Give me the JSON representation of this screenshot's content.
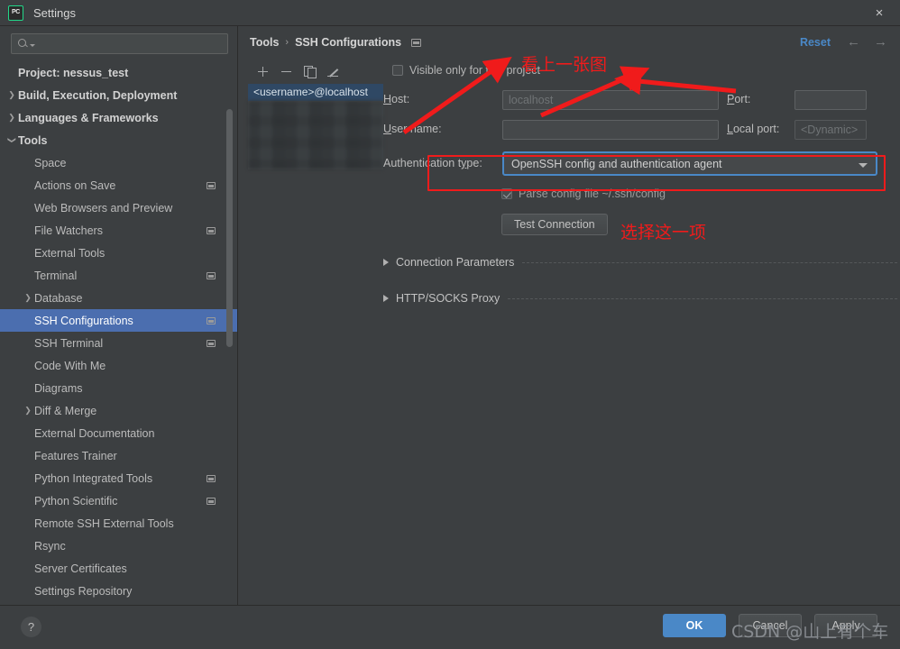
{
  "window": {
    "title": "Settings",
    "logo_text": "PC",
    "close_icon": "×"
  },
  "sidebar": {
    "search": {
      "value": "",
      "placeholder": ""
    },
    "items": [
      {
        "label": "Project: nessus_test",
        "indent": 0,
        "bold": true,
        "arrow": "",
        "badge": false,
        "selected": false
      },
      {
        "label": "Build, Execution, Deployment",
        "indent": 0,
        "bold": true,
        "arrow": "right",
        "badge": false,
        "selected": false
      },
      {
        "label": "Languages & Frameworks",
        "indent": 0,
        "bold": true,
        "arrow": "right",
        "badge": false,
        "selected": false
      },
      {
        "label": "Tools",
        "indent": 0,
        "bold": true,
        "arrow": "down",
        "badge": false,
        "selected": false
      },
      {
        "label": "Space",
        "indent": 1,
        "bold": false,
        "arrow": "",
        "badge": false,
        "selected": false
      },
      {
        "label": "Actions on Save",
        "indent": 1,
        "bold": false,
        "arrow": "",
        "badge": true,
        "selected": false
      },
      {
        "label": "Web Browsers and Preview",
        "indent": 1,
        "bold": false,
        "arrow": "",
        "badge": false,
        "selected": false
      },
      {
        "label": "File Watchers",
        "indent": 1,
        "bold": false,
        "arrow": "",
        "badge": true,
        "selected": false
      },
      {
        "label": "External Tools",
        "indent": 1,
        "bold": false,
        "arrow": "",
        "badge": false,
        "selected": false
      },
      {
        "label": "Terminal",
        "indent": 1,
        "bold": false,
        "arrow": "",
        "badge": true,
        "selected": false
      },
      {
        "label": "Database",
        "indent": 1,
        "bold": false,
        "arrow": "right",
        "badge": false,
        "selected": false
      },
      {
        "label": "SSH Configurations",
        "indent": 1,
        "bold": false,
        "arrow": "",
        "badge": true,
        "selected": true
      },
      {
        "label": "SSH Terminal",
        "indent": 1,
        "bold": false,
        "arrow": "",
        "badge": true,
        "selected": false
      },
      {
        "label": "Code With Me",
        "indent": 1,
        "bold": false,
        "arrow": "",
        "badge": false,
        "selected": false
      },
      {
        "label": "Diagrams",
        "indent": 1,
        "bold": false,
        "arrow": "",
        "badge": false,
        "selected": false
      },
      {
        "label": "Diff & Merge",
        "indent": 1,
        "bold": false,
        "arrow": "right",
        "badge": false,
        "selected": false
      },
      {
        "label": "External Documentation",
        "indent": 1,
        "bold": false,
        "arrow": "",
        "badge": false,
        "selected": false
      },
      {
        "label": "Features Trainer",
        "indent": 1,
        "bold": false,
        "arrow": "",
        "badge": false,
        "selected": false
      },
      {
        "label": "Python Integrated Tools",
        "indent": 1,
        "bold": false,
        "arrow": "",
        "badge": true,
        "selected": false
      },
      {
        "label": "Python Scientific",
        "indent": 1,
        "bold": false,
        "arrow": "",
        "badge": true,
        "selected": false
      },
      {
        "label": "Remote SSH External Tools",
        "indent": 1,
        "bold": false,
        "arrow": "",
        "badge": false,
        "selected": false
      },
      {
        "label": "Rsync",
        "indent": 1,
        "bold": false,
        "arrow": "",
        "badge": false,
        "selected": false
      },
      {
        "label": "Server Certificates",
        "indent": 1,
        "bold": false,
        "arrow": "",
        "badge": false,
        "selected": false
      },
      {
        "label": "Settings Repository",
        "indent": 1,
        "bold": false,
        "arrow": "",
        "badge": false,
        "selected": false
      }
    ]
  },
  "main": {
    "breadcrumb": {
      "root": "Tools",
      "separator": "›",
      "current": "SSH Configurations"
    },
    "reset_label": "Reset",
    "nav_back_icon": "←",
    "nav_forward_icon": "→",
    "list": {
      "toolbar": {
        "add": "+",
        "remove": "−",
        "copy": "copy",
        "edit": "edit"
      },
      "selected_item": "<username>@localhost"
    },
    "form": {
      "visible_only_label": "Visible only for this project",
      "visible_only_checked": false,
      "host_label": "Host:",
      "host_value": "",
      "host_placeholder": "localhost",
      "port_label": "Port:",
      "port_value": "",
      "username_label": "User name:",
      "username_value": "",
      "local_port_label": "Local port:",
      "local_port_value": "<Dynamic>",
      "auth_type_label": "Authentication type:",
      "auth_type_value": "OpenSSH config and authentication agent",
      "parse_config_label": "Parse config file ~/.ssh/config",
      "parse_config_checked": true,
      "test_connection_label": "Test Connection",
      "section_connection": "Connection Parameters",
      "section_proxy": "HTTP/SOCKS Proxy"
    }
  },
  "bottom": {
    "help_label": "?",
    "ok_label": "OK",
    "cancel_label": "Cancel",
    "apply_label": "Apply",
    "watermark": "CSDN @山上有个车"
  },
  "annotations": {
    "note_top": "看上一张图",
    "note_select": "选择这一项",
    "color": "#f01b1b"
  }
}
